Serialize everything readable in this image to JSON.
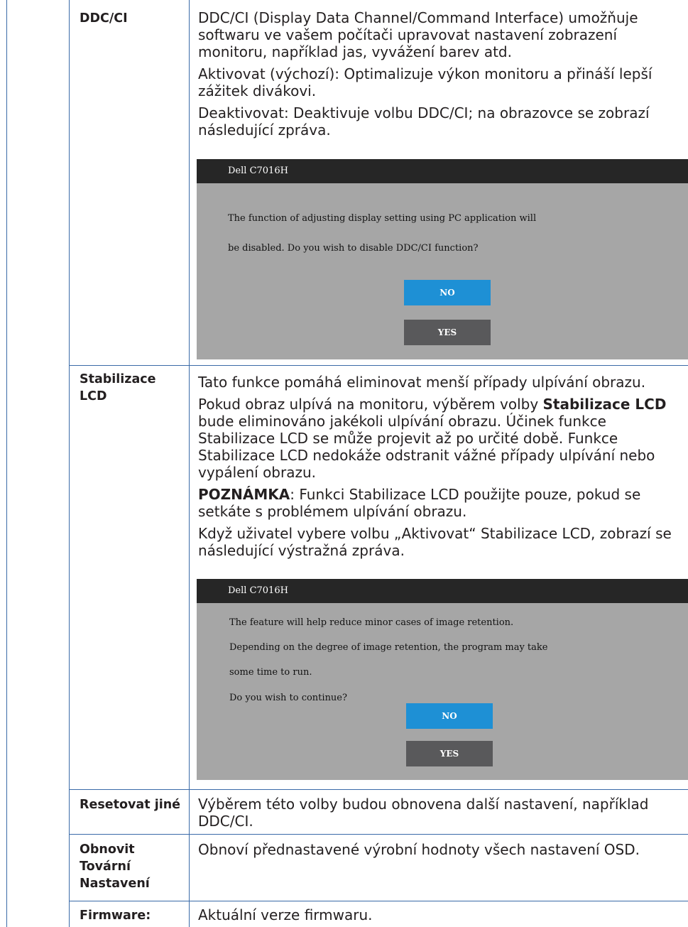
{
  "rows": {
    "ddc": {
      "label": "DDC/CI",
      "p1": "DDC/CI (Display Data Channel/Command Interface) umožňuje softwaru ve vašem počítači upravovat nastavení zobrazení monitoru, například jas, vyvážení barev atd.",
      "p2": "Aktivovat (výchozí): Optimalizuje výkon monitoru a přináší lepší zážitek divákovi.",
      "p3": "Deaktivovat: Deaktivuje volbu DDC/CI; na obrazovce se zobrazí následující zpráva.",
      "dialog": {
        "title": "Dell  C7016H",
        "line1": "The function of adjusting display setting using PC application will",
        "line2": "be disabled. Do you wish to disable DDC/CI function?",
        "no": "NO",
        "yes": "YES"
      }
    },
    "lcd": {
      "label": "Stabilizace LCD",
      "p1": "Tato funkce pomáhá eliminovat menší případy ulpívání obrazu.",
      "p2_pre": "Pokud obraz ulpívá na monitoru, výběrem volby ",
      "p2_bold": "Stabilizace LCD",
      "p2_post": " bude eliminováno jakékoli ulpívání obrazu. Účinek funkce Stabilizace LCD se může projevit až po určité době. Funkce Stabilizace LCD nedokáže odstranit vážné případy ulpívání nebo vypálení obrazu.",
      "p3_bold": "POZNÁMKA",
      "p3_post": ": Funkci Stabilizace LCD použijte pouze, pokud se setkáte s problémem ulpívání obrazu.",
      "p4": "Když uživatel vybere volbu „Aktivovat“ Stabilizace LCD, zobrazí se následující výstražná zpráva.",
      "dialog": {
        "title": "Dell  C7016H",
        "line1": "The feature will help reduce minor cases of image retention.",
        "line2": "Depending on the degree of image retention, the program may take",
        "line3": "some time to run.",
        "line4": "Do you wish to continue?",
        "no": "NO",
        "yes": "YES"
      }
    },
    "reset_other": {
      "label": "Resetovat jiné",
      "desc": "Výběrem této volby budou obnovena další nastavení, například DDC/CI."
    },
    "factory_reset": {
      "label": "Obnovit Tovární Nastavení",
      "desc": "Obnoví přednastavené výrobní hodnoty všech nastavení OSD."
    },
    "firmware": {
      "label": "Firmware:",
      "desc": "Aktuální verze firmwaru."
    }
  }
}
